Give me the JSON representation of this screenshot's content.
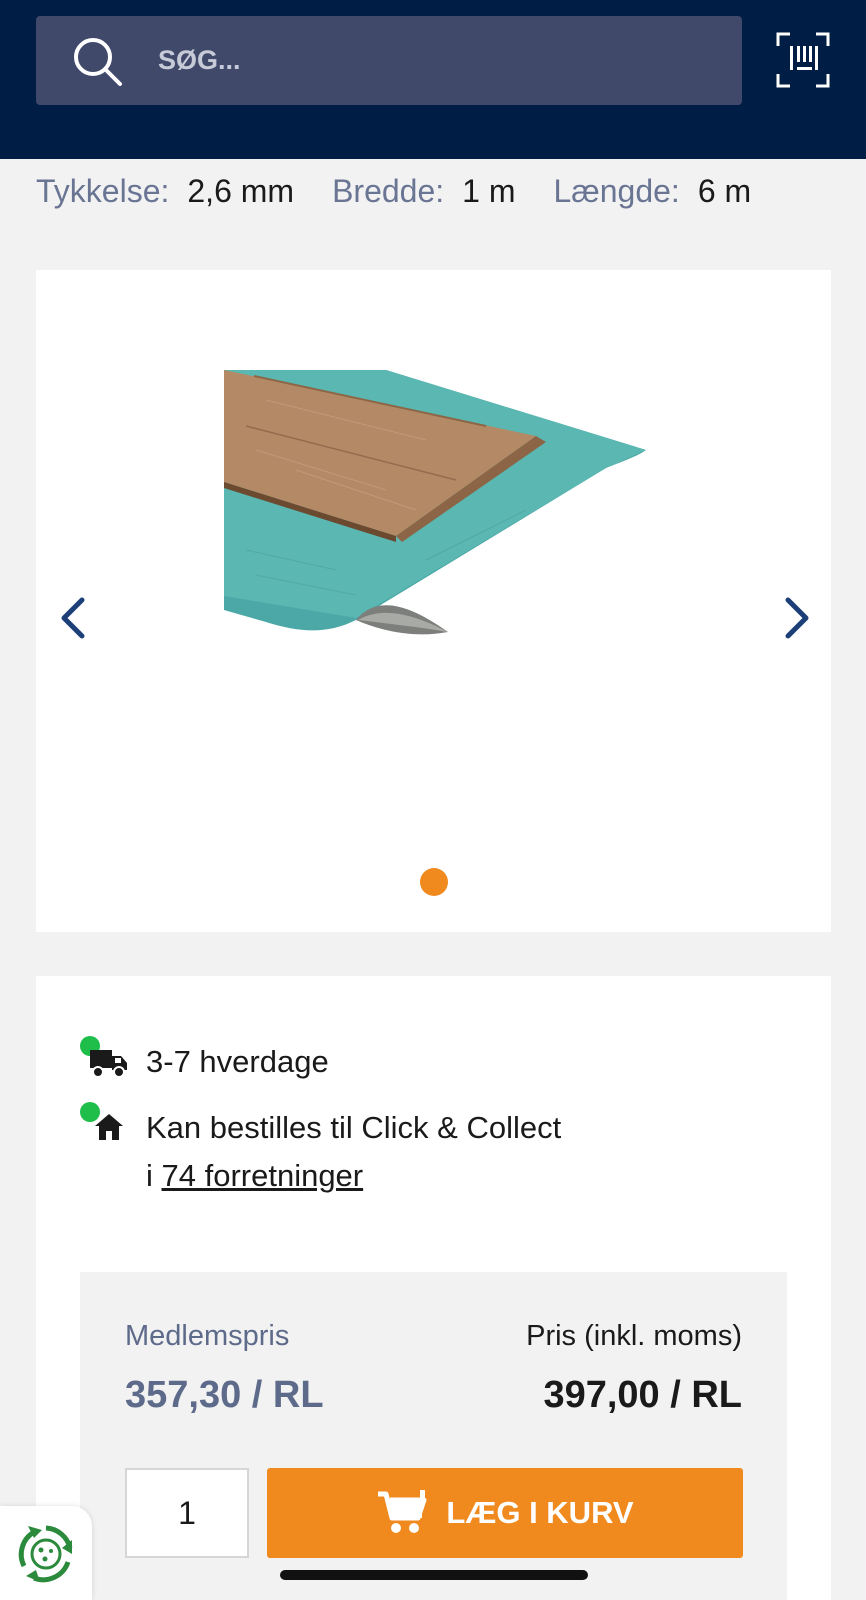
{
  "header": {
    "search_placeholder": "SØG..."
  },
  "specs": [
    {
      "label": "Tykkelse:",
      "value": "2,6 mm"
    },
    {
      "label": "Bredde:",
      "value": "1 m"
    },
    {
      "label": "Længde:",
      "value": "6 m"
    }
  ],
  "gallery": {
    "image_count": 1,
    "current_index": 1
  },
  "availability": {
    "delivery_text": "3-7 hverdage",
    "collect_text_line1": "Kan bestilles til Click & Collect",
    "collect_text_prefix": "i ",
    "collect_link": "74 forretninger"
  },
  "pricing": {
    "member_label": "Medlemspris",
    "member_price": "357,30 / RL",
    "price_label": "Pris (inkl. moms)",
    "price_value": "397,00 / RL"
  },
  "cart": {
    "quantity": "1",
    "add_label": "LÆG I KURV"
  },
  "colors": {
    "header_bg": "#001d46",
    "accent": "#f08a1f",
    "status_green": "#1fbe4a",
    "member_price": "#5d6a8a"
  },
  "icons": [
    "search-icon",
    "barcode-scan-icon",
    "chevron-left-icon",
    "chevron-right-icon",
    "truck-icon",
    "house-icon",
    "cart-icon",
    "eco-recycle-icon"
  ]
}
